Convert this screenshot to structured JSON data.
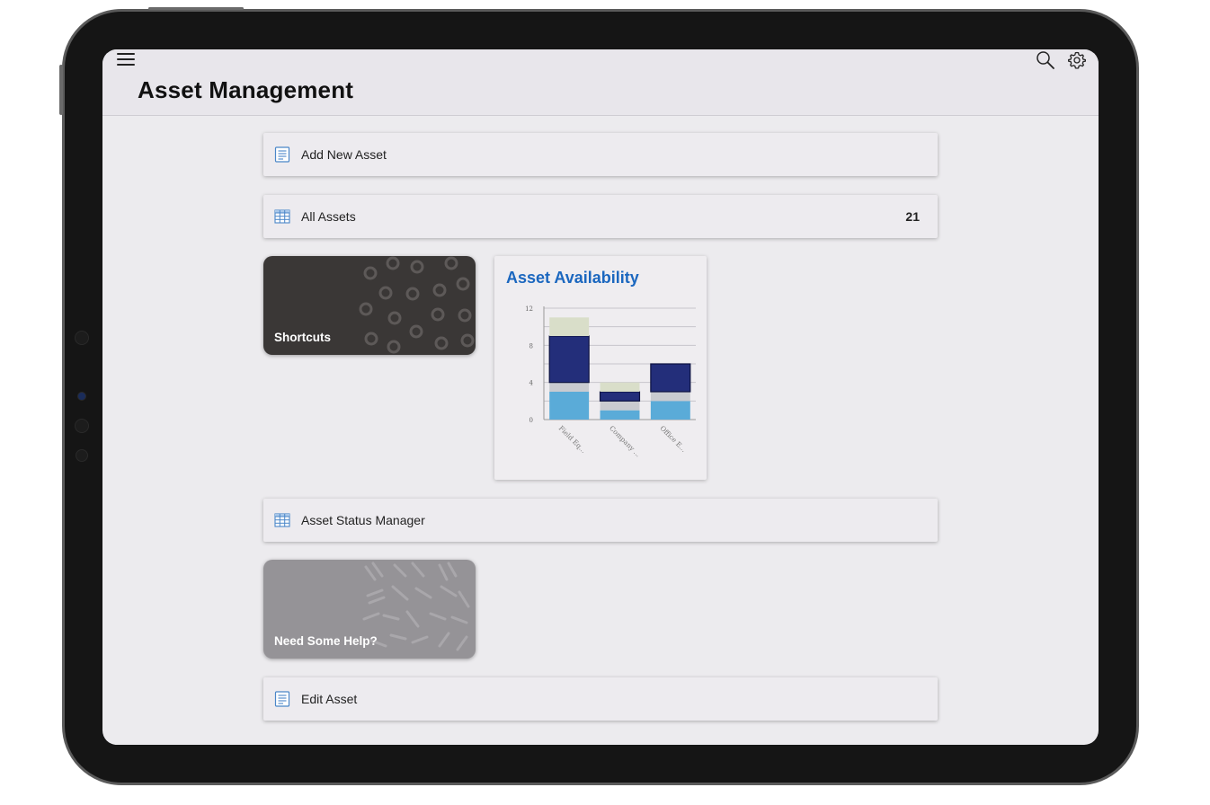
{
  "app": {
    "title": "Asset Management"
  },
  "header": {
    "menu_icon": "hamburger-icon",
    "search_icon": "search-icon",
    "settings_icon": "gear-icon"
  },
  "rows": {
    "add_new_asset": {
      "label": "Add New Asset",
      "icon": "document-icon"
    },
    "all_assets": {
      "label": "All Assets",
      "count": "21",
      "icon": "table-icon"
    },
    "asset_status_manager": {
      "label": "Asset Status Manager",
      "icon": "table-icon"
    },
    "edit_asset": {
      "label": "Edit Asset",
      "icon": "document-icon"
    }
  },
  "tiles": {
    "shortcuts": {
      "label": "Shortcuts",
      "color": "#3a3736"
    },
    "help": {
      "label": "Need Some Help?",
      "color": "#959397"
    }
  },
  "chart_card": {
    "title": "Asset Availability"
  },
  "colors": {
    "accent": "#1b67bf",
    "navy": "#232e7a",
    "light_blue": "#5aabd8",
    "gray": "#c9cbd0",
    "sage": "#d9dec9"
  },
  "chart_data": {
    "type": "bar",
    "stacked": true,
    "title": "Asset Availability",
    "categories": [
      "Field Eq...",
      "Company ...",
      "Office E..."
    ],
    "series": [
      {
        "values": [
          3,
          1,
          2
        ],
        "color": "#5aabd8"
      },
      {
        "values": [
          1,
          1,
          1
        ],
        "color": "#c9cbd0"
      },
      {
        "values": [
          5,
          1,
          3
        ],
        "color": "#232e7a"
      },
      {
        "values": [
          2,
          1,
          0
        ],
        "color": "#d9dec9"
      }
    ],
    "y_ticks": [
      "0",
      "4",
      "8",
      "12"
    ],
    "ylim": [
      0,
      12
    ],
    "grid": true
  }
}
